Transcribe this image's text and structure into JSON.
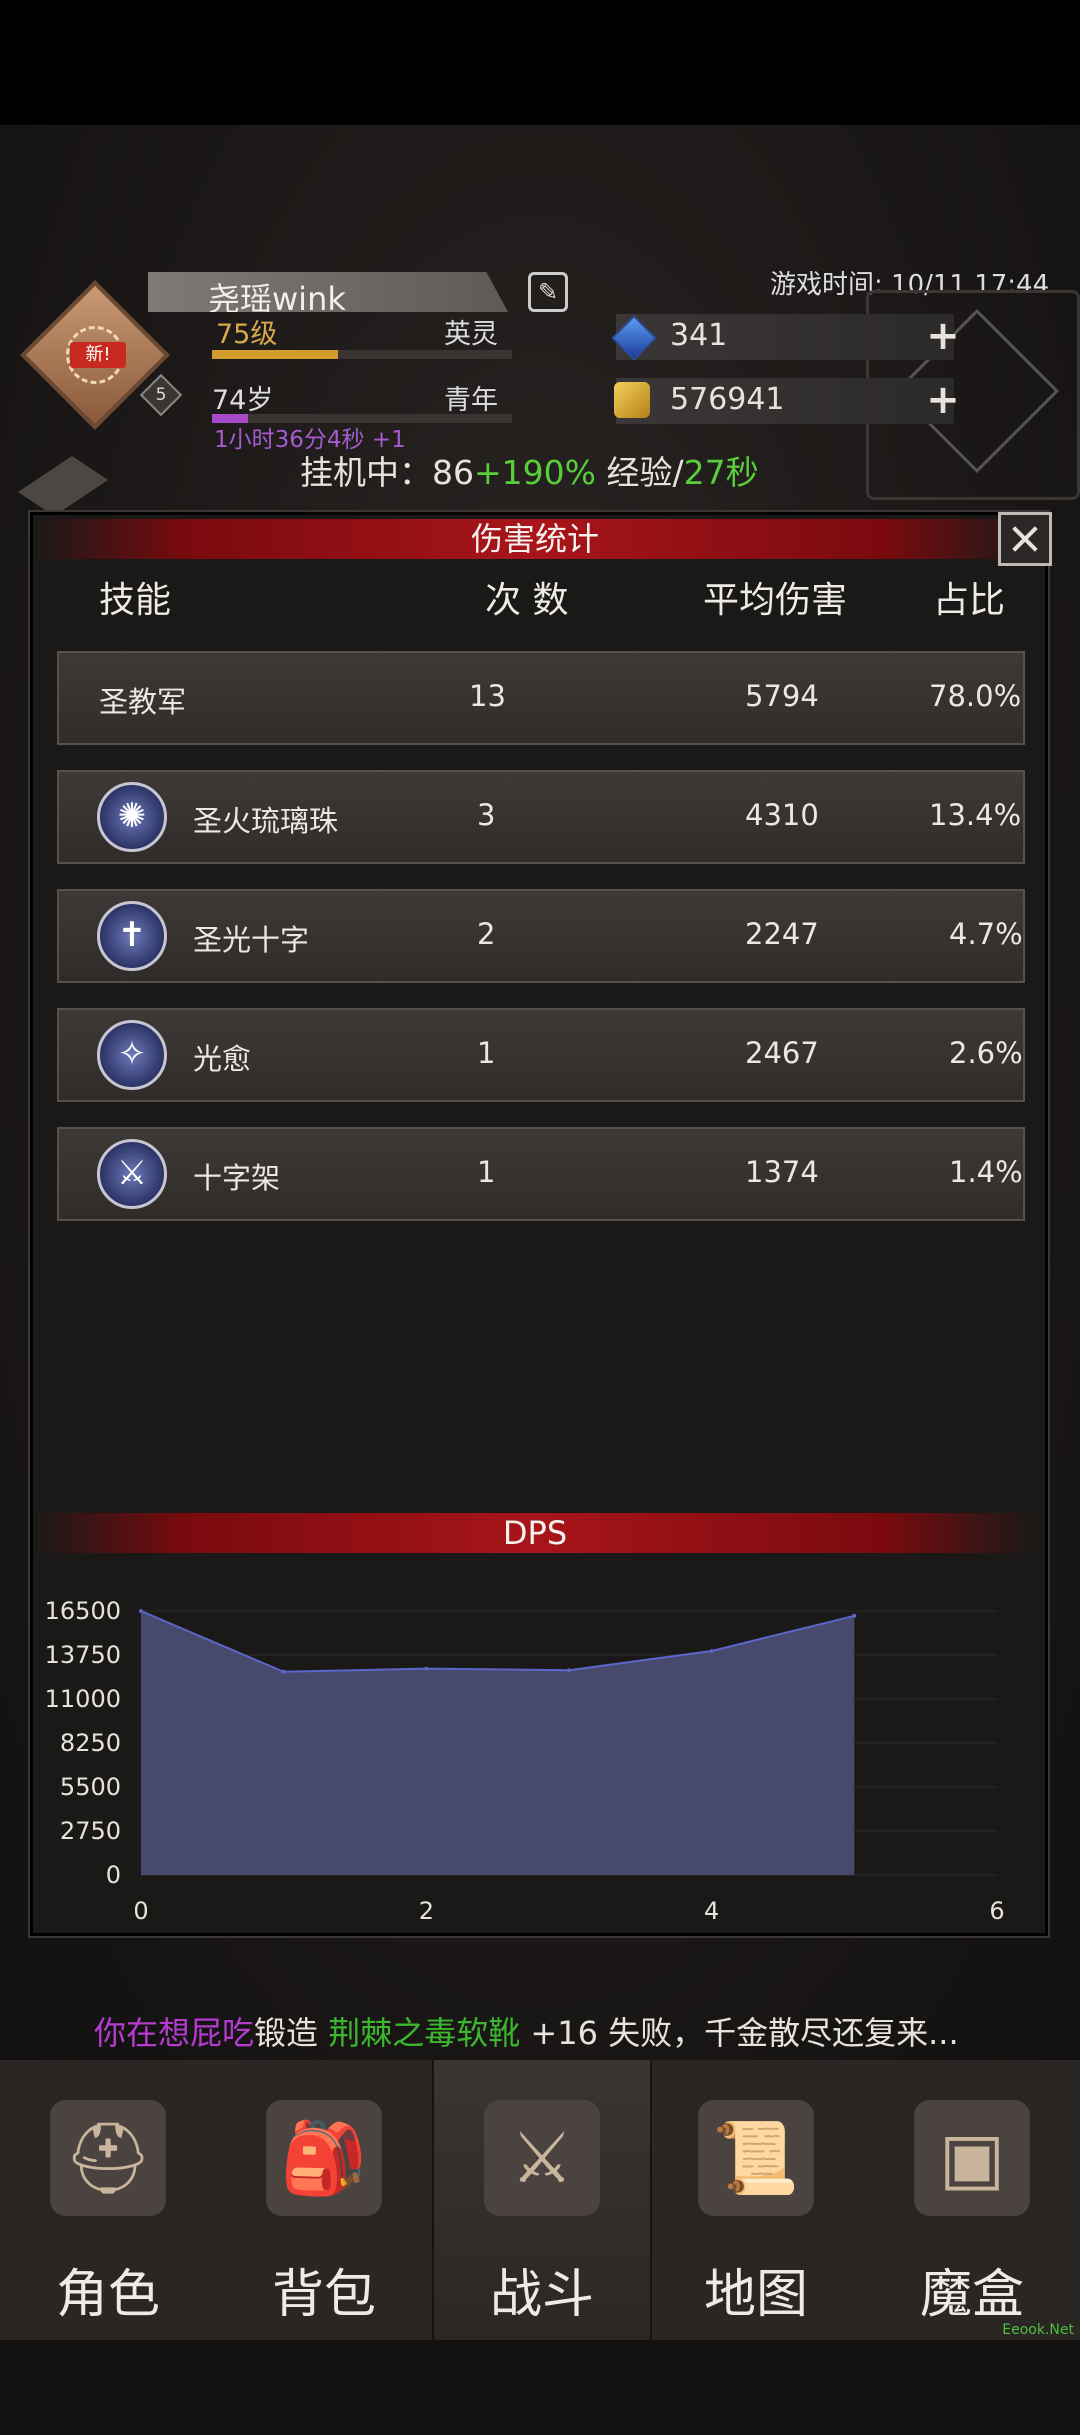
{
  "header": {
    "player_name": "尧瑶wink",
    "level": "75级",
    "rank": "英灵",
    "age": "74岁",
    "life_stage": "青年",
    "timer": "1小时36分4秒 +1",
    "avatar_badge": "新!",
    "avatar_level": "5",
    "game_time": "游戏时间: 10/11 17:44",
    "diamonds": "341",
    "gold": "576941",
    "idle_prefix": "挂机中：86",
    "idle_bonus": "+190%",
    "idle_exp": " 经验/",
    "idle_rate": "27秒"
  },
  "damage_panel": {
    "title": "伤害统计",
    "columns": [
      "技能",
      "次 数",
      "平均伤害",
      "占比"
    ],
    "rows": [
      {
        "icon": "holy-army-icon",
        "name": "圣教军",
        "count": "13",
        "avg": "5794",
        "pct": "78.0%"
      },
      {
        "icon": "holy-fire-orb-icon",
        "name": "圣火琉璃珠",
        "count": "3",
        "avg": "4310",
        "pct": "13.4%"
      },
      {
        "icon": "holy-cross-icon",
        "name": "圣光十字",
        "count": "2",
        "avg": "2247",
        "pct": "4.7%"
      },
      {
        "icon": "heal-light-icon",
        "name": "光愈",
        "count": "1",
        "avg": "2467",
        "pct": "2.6%"
      },
      {
        "icon": "crucifix-sword-icon",
        "name": "十字架",
        "count": "1",
        "avg": "1374",
        "pct": "1.4%"
      }
    ]
  },
  "chart_data": {
    "type": "area",
    "title": "DPS",
    "x": [
      0,
      1,
      2,
      3,
      4,
      5
    ],
    "values": [
      16500,
      12700,
      12900,
      12800,
      14000,
      16200
    ],
    "xlim": [
      0,
      6
    ],
    "ylim": [
      0,
      16500
    ],
    "xticks": [
      "0",
      "2",
      "4",
      "6"
    ],
    "yticks": [
      "16500",
      "13750",
      "11000",
      "8250",
      "5500",
      "2750",
      "0"
    ],
    "fill_color": "#474a6d",
    "line_color": "#5a66c9"
  },
  "message": [
    {
      "text": "你在想屁吃",
      "color": "#b43bd0"
    },
    {
      "text": "锻造 ",
      "color": "#e6e2dc"
    },
    {
      "text": "荆棘之毒软靴",
      "color": "#3cb62e"
    },
    {
      "text": " +16 失败，千金散尽还复来...",
      "color": "#e6e2dc"
    }
  ],
  "nav": [
    {
      "label": "角色",
      "icon": "helmet-icon"
    },
    {
      "label": "背包",
      "icon": "backpack-icon"
    },
    {
      "label": "战斗",
      "icon": "sword-shield-icon"
    },
    {
      "label": "地图",
      "icon": "scroll-map-icon"
    },
    {
      "label": "魔盒",
      "icon": "magic-box-icon"
    }
  ],
  "watermark": "Eeook.Net",
  "colors": {
    "accent_red": "#a8151a",
    "exp_gold": "#d49b2d",
    "green": "#58cf3a"
  }
}
